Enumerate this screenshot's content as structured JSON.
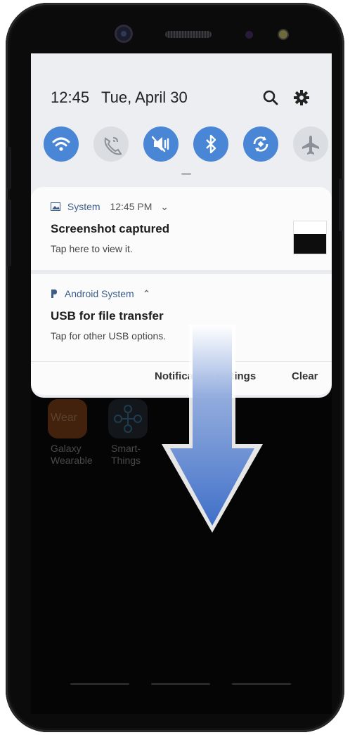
{
  "status": {
    "time": "12:45",
    "date": "Tue, April 30"
  },
  "top_icons": [
    "search-icon",
    "gear-icon"
  ],
  "quick_settings": [
    {
      "name": "wifi",
      "icon": "wifi-icon",
      "active": true
    },
    {
      "name": "wifi-calling",
      "icon": "wifi-calling-icon",
      "active": false
    },
    {
      "name": "sound",
      "icon": "mute-icon",
      "active": true
    },
    {
      "name": "bluetooth",
      "icon": "bluetooth-icon",
      "active": true
    },
    {
      "name": "auto-rotate",
      "icon": "rotate-icon",
      "active": true
    },
    {
      "name": "airplane-mode",
      "icon": "airplane-icon",
      "active": false
    }
  ],
  "notifications": [
    {
      "app": "System",
      "time": "12:45 PM",
      "title": "Screenshot captured",
      "body": "Tap here to view it."
    },
    {
      "app": "Android System",
      "title": "USB for file transfer",
      "body": "Tap for other USB options."
    }
  ],
  "actions": {
    "notification_settings": "Notification settings",
    "clear": "Clear"
  },
  "home_apps": [
    {
      "label_line1": "Galaxy",
      "label_line2": "Wearable",
      "tile_text": "Wear"
    },
    {
      "label_line1": "Smart-",
      "label_line2": "Things"
    }
  ],
  "colors": {
    "accent": "#4a86d6",
    "arrow": "#3f6fc8"
  }
}
